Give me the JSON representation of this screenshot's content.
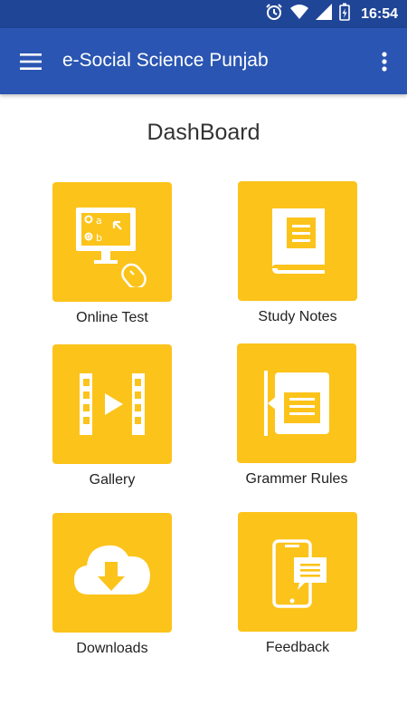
{
  "status_bar": {
    "time": "16:54",
    "icons": [
      "alarm-icon",
      "wifi-icon",
      "signal-icon",
      "battery-icon"
    ]
  },
  "app_bar": {
    "title": "e-Social Science Punjab",
    "menu_icon": "hamburger-menu-icon",
    "overflow_icon": "more-vert-icon"
  },
  "dashboard": {
    "title": "DashBoard",
    "tiles": [
      {
        "label": "Online Test",
        "icon": "online-test-icon"
      },
      {
        "label": "Study Notes",
        "icon": "book-icon"
      },
      {
        "label": "Gallery",
        "icon": "video-gallery-icon"
      },
      {
        "label": "Grammer Rules",
        "icon": "rules-document-icon"
      },
      {
        "label": "Downloads",
        "icon": "cloud-download-icon"
      },
      {
        "label": "Feedback",
        "icon": "phone-feedback-icon"
      }
    ]
  },
  "colors": {
    "status_bar": "#1f4597",
    "app_bar": "#2a55b2",
    "tile": "#fcc31b"
  },
  "quiz_icon_labels": {
    "a": "a",
    "b": "b"
  }
}
